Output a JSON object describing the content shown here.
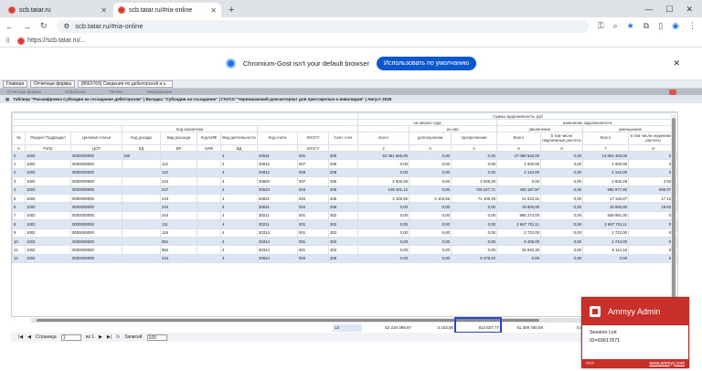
{
  "browser": {
    "tabs": [
      {
        "title": "scb.tatar.ru"
      },
      {
        "title": "scb.tatar.ru/#ria-online"
      }
    ],
    "url": "scb.tatar.ru/#ria-online",
    "bookmark": "https://scb.tatar.ru/...",
    "infobar": {
      "text": "Chromium-Gost isn't your default browser",
      "button": "Использовать по умолчанию"
    }
  },
  "app": {
    "tabs": [
      "Главная",
      "Отчетные формы",
      "[8563769] Сведения по дебиторской и к..."
    ],
    "menu": [
      "Отчетные формы",
      "Обработка",
      "Печати",
      "Информация"
    ],
    "report_title": "Таблица \"Расшифровка Субсидии на госзадание дебиторская\" | Вкладка \"Субсидии на госзадание\" | ГАУСО \"Черемшанский дом-интернат для престарелых и инвалидов\" | Август 2026"
  },
  "grid": {
    "group_headers": {
      "debt": "Сумма задолженности, руб",
      "start_year": "на начало года",
      "change": "изменение задолженности",
      "of_them": "из них:",
      "increase": "увеличение",
      "decrease": "уменьшение",
      "analytics": "Код аналитики"
    },
    "columns": [
      "№",
      "Раздел/ Подраздел",
      "Целевая статья",
      "Код дохода",
      "Вид расхода",
      "Код КИФ",
      "Вид деятельности",
      "Код счета",
      "КОСГУ",
      "Синт. счет",
      "всего",
      "долгосрочная",
      "просроченная",
      "Всего",
      "в том числе неденежные расчеты",
      "Всего",
      "в том числе неденежные расчеты"
    ],
    "col_numbers": [
      "0",
      "РзПр",
      "ЦСР",
      "КД",
      "ВР",
      "КИФ",
      "ВД",
      "",
      "КОСГУ",
      "",
      "2",
      "3",
      "4",
      "5",
      "6",
      "7",
      "8"
    ],
    "rows": [
      [
        "0",
        "1002",
        "0000000000",
        "130",
        "",
        "",
        "4",
        "20531",
        "001",
        "205",
        "52 061 665,00",
        "0,00",
        "0,00",
        "27 098 520,00",
        "0,00",
        "14 804 453,00",
        "0,00"
      ],
      [
        "1",
        "1002",
        "0000000000",
        "",
        "112",
        "",
        "4",
        "20812",
        "007",
        "208",
        "0,00",
        "0,00",
        "0,00",
        "1 000,00",
        "0,00",
        "1 000,00",
        "0,00"
      ],
      [
        "2",
        "1002",
        "0000000000",
        "",
        "112",
        "",
        "4",
        "20812",
        "008",
        "208",
        "0,00",
        "0,00",
        "0,00",
        "4 142,00",
        "0,00",
        "4 142,00",
        "0,00"
      ],
      [
        "3",
        "1002",
        "0000000000",
        "",
        "244",
        "",
        "4",
        "20826",
        "007",
        "206",
        "4 925,29",
        "0,00",
        "4 925,29",
        "0,00",
        "0,00",
        "4 925,29",
        "4 925,2"
      ],
      [
        "4",
        "1002",
        "0000000000",
        "",
        "247",
        "",
        "4",
        "20623",
        "004",
        "206",
        "149 401,12",
        "0,00",
        "729 247,71",
        "469 187,87",
        "0,00",
        "596 977,90",
        "596 977,9"
      ],
      [
        "5",
        "1002",
        "0000000000",
        "",
        "244",
        "",
        "4",
        "20621",
        "004",
        "206",
        "3 103,56",
        "3 103,56",
        "71 105,29",
        "14 023,31",
        "0,00",
        "17 126,87",
        "17 126,8"
      ],
      [
        "6",
        "1002",
        "0000000000",
        "",
        "244",
        "",
        "4",
        "20631",
        "004",
        "206",
        "0,00",
        "0,00",
        "0,00",
        "19 600,00",
        "0,00",
        "19 600,00",
        "19 600,0"
      ],
      [
        "7",
        "1002",
        "0000000000",
        "",
        "244",
        "",
        "4",
        "30211",
        "001",
        "302",
        "0,00",
        "0,00",
        "0,00",
        "995 274,00",
        "0,00",
        "949 991,00",
        "0,00"
      ],
      [
        "8",
        "1002",
        "0000000000",
        "",
        "111",
        "",
        "4",
        "30211",
        "001",
        "302",
        "0,00",
        "0,00",
        "0,00",
        "2 667 701,11",
        "0,00",
        "2 667 701,11",
        "0,00"
      ],
      [
        "9",
        "1002",
        "0000000000",
        "",
        "119",
        "",
        "4",
        "30314",
        "001",
        "303",
        "0,00",
        "0,00",
        "0,00",
        "2 722,00",
        "0,00",
        "2 722,00",
        "0,00"
      ],
      [
        "10",
        "1002",
        "0000000000",
        "",
        "851",
        "",
        "4",
        "30314",
        "001",
        "303",
        "0,00",
        "0,00",
        "0,00",
        "9 406,00",
        "0,00",
        "4 744,00",
        "0,00"
      ],
      [
        "11",
        "1002",
        "0000000000",
        "",
        "852",
        "",
        "4",
        "30314",
        "001",
        "303",
        "0,00",
        "0,00",
        "0,00",
        "25 932,30",
        "0,00",
        "5 114,16",
        "0,00"
      ],
      [
        "12",
        "1002",
        "0000000000",
        "",
        "244",
        "",
        "4",
        "20634",
        "004",
        "206",
        "0,00",
        "0,00",
        "8 478,40",
        "0,00",
        "0,00",
        "0,00",
        "0,00"
      ]
    ],
    "totals": {
      "count": "13",
      "total": "52 219 399,97",
      "long": "3 103,56",
      "overdue": "813 827,77",
      "inc": "41 309 750,59",
      "inc2": "0,00"
    }
  },
  "pager": {
    "page_label": "Страница",
    "page": "1",
    "of": "из 1",
    "records_label": "Записей",
    "records": "100"
  },
  "ammyy": {
    "title": "Ammyy Admin",
    "session": "Session List",
    "id": "ID=93617871",
    "footer_left": ">>>",
    "footer_link": "www.ammyy.com"
  }
}
